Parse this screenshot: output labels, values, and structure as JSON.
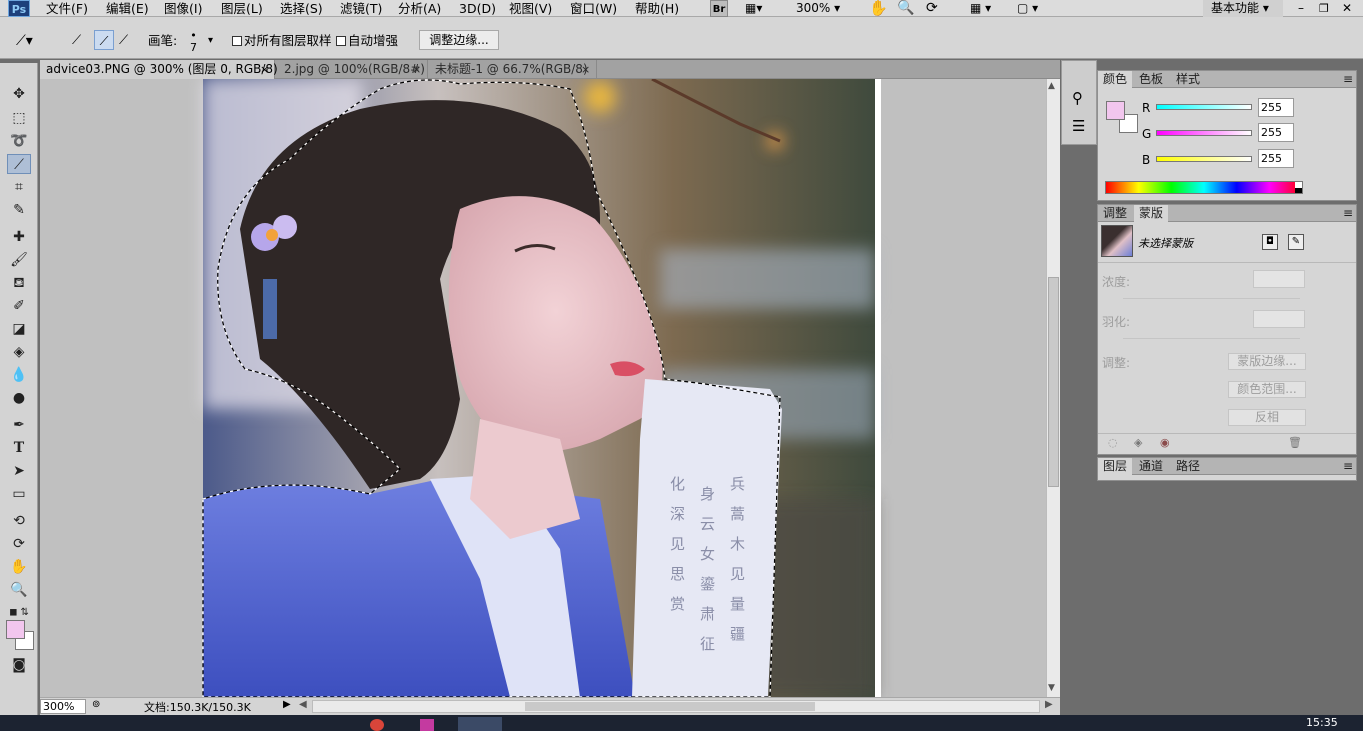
{
  "menubar": {
    "logo": "Ps",
    "items": [
      "文件(F)",
      "编辑(E)",
      "图像(I)",
      "图层(L)",
      "选择(S)",
      "滤镜(T)",
      "分析(A)",
      "3D(D)",
      "视图(V)",
      "窗口(W)",
      "帮助(H)"
    ],
    "bridge_label": "Br",
    "zoom": "300%",
    "workspace": "基本功能"
  },
  "options": {
    "brush_label": "画笔:",
    "brush_size": "7",
    "sample_all_layers": "对所有图层取样",
    "auto_enhance": "自动增强",
    "refine_edge": "调整边缘..."
  },
  "tabs": [
    {
      "label": "advice03.PNG @ 300% (图层 0, RGB/8)",
      "close": "×"
    },
    {
      "label": "2.jpg @ 100%(RGB/8#)",
      "close": "×"
    },
    {
      "label": "未标题-1 @ 66.7%(RGB/8)",
      "close": "×"
    }
  ],
  "status": {
    "zoom": "300%",
    "doc_info": "文档:150.3K/150.3K"
  },
  "color_panel": {
    "tabs": [
      "颜色",
      "色板",
      "样式"
    ],
    "fg_color": "#f2c6ee",
    "r_label": "R",
    "g_label": "G",
    "b_label": "B",
    "r": "255",
    "g": "255",
    "b": "255"
  },
  "masks_panel": {
    "tabs": [
      "调整",
      "蒙版"
    ],
    "no_mask": "未选择蒙版",
    "density_label": "浓度:",
    "feather_label": "羽化:",
    "refine_label": "调整:",
    "mask_edge": "蒙版边缘...",
    "color_range": "颜色范围...",
    "invert": "反相"
  },
  "layers_panel": {
    "tabs": [
      "图层",
      "通道",
      "路径"
    ]
  },
  "taskbar": {
    "time": "15:35"
  }
}
